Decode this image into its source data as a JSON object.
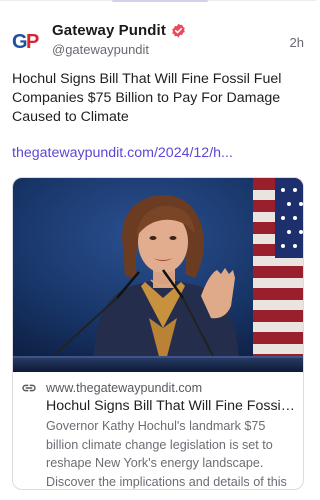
{
  "post": {
    "author": {
      "display_name": "Gateway Pundit",
      "handle": "@gatewaypundit",
      "avatar_text": "GP",
      "verified": true
    },
    "timestamp": "2h",
    "text": "Hochul Signs Bill That Will Fine Fossil Fuel Companies $75 Billion to Pay For Damage Caused to Climate",
    "link_text": "thegatewaypundit.com/2024/12/h...",
    "card": {
      "domain": "www.thegatewaypundit.com",
      "title": "Hochul Signs Bill That Will Fine Fossil ...",
      "description": "Governor Kathy Hochul's landmark $75 billion climate change legislation is set to reshape New York's energy landscape. Discover the implications and details of this historic mea..."
    }
  },
  "icons": {
    "verified": "verified-badge-icon",
    "link": "link-icon"
  },
  "colors": {
    "link": "#6046d6",
    "verified": "#e84a5f",
    "avatar_blue": "#1f4fa0",
    "avatar_red": "#d8262f"
  }
}
